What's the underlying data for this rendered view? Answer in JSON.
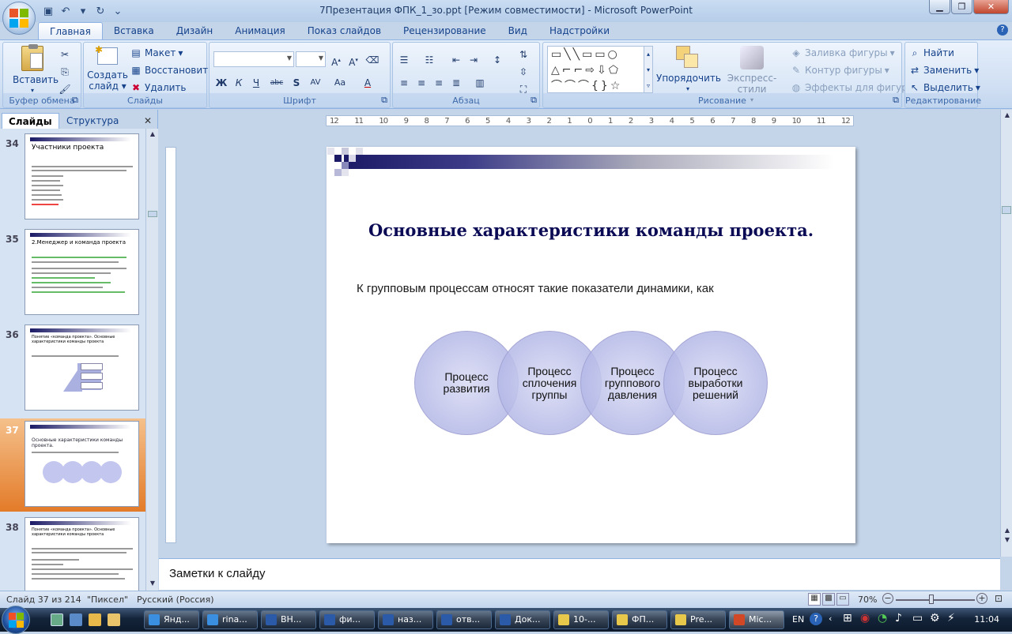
{
  "window": {
    "title": "7Презентация ФПК_1_зо.ppt [Режим совместимости] - Microsoft PowerPoint"
  },
  "tabs": [
    "Главная",
    "Вставка",
    "Дизайн",
    "Анимация",
    "Показ слайдов",
    "Рецензирование",
    "Вид",
    "Надстройки"
  ],
  "ribbon": {
    "clipboard": {
      "title": "Буфер обмена",
      "paste": "Вставить"
    },
    "slides": {
      "title": "Слайды",
      "create": "Создать",
      "create2": "слайд",
      "layout": "Макет",
      "reset": "Восстановить",
      "delete": "Удалить"
    },
    "font": {
      "title": "Шрифт"
    },
    "paragraph": {
      "title": "Абзац"
    },
    "drawing": {
      "title": "Рисование",
      "arrange": "Упорядочить",
      "quickstyles": "Экспресс-стили",
      "fill": "Заливка фигуры",
      "outline": "Контур фигуры",
      "effects": "Эффекты для фигур"
    },
    "editing": {
      "title": "Редактирование",
      "find": "Найти",
      "replace": "Заменить",
      "select": "Выделить"
    }
  },
  "left_panel": {
    "tab_slides": "Слайды",
    "tab_outline": "Структура",
    "thumbs": [
      {
        "num": "34",
        "title": "Участники проекта"
      },
      {
        "num": "35",
        "title": "2.Менеджер и команда проекта"
      },
      {
        "num": "36",
        "title": "Понятие «команда проекта». Основные характеристики команды проекта"
      },
      {
        "num": "37",
        "title": "Основные характеристики команды проекта."
      },
      {
        "num": "38",
        "title": "Понятие «команда проекта». Основные характеристики команды проекта"
      }
    ]
  },
  "ruler": {
    "h": [
      "12",
      "11",
      "10",
      "9",
      "8",
      "7",
      "6",
      "5",
      "4",
      "3",
      "2",
      "1",
      "0",
      "1",
      "2",
      "3",
      "4",
      "5",
      "6",
      "7",
      "8",
      "9",
      "10",
      "11",
      "12"
    ]
  },
  "slide": {
    "title": "Основные характеристики команды проекта.",
    "text": "К групповым процессам относят такие показатели динамики, как",
    "circles": [
      "Процесс развития",
      "Процесс сплочения группы",
      "Процесс группового давления",
      "Процесс выработки решений"
    ]
  },
  "notes": {
    "placeholder": "Заметки к слайду"
  },
  "status": {
    "slide": "Слайд 37 из 214",
    "theme": "\"Пиксел\"",
    "lang": "Русский (Россия)",
    "zoom": "70%"
  },
  "taskbar": {
    "buttons": [
      "Янд...",
      "rina...",
      "ВН...",
      "фи...",
      "наз...",
      "отв...",
      "Док...",
      "10-...",
      "ФП...",
      "Pre...",
      "Mic..."
    ],
    "lang": "EN",
    "time": "11:04"
  }
}
